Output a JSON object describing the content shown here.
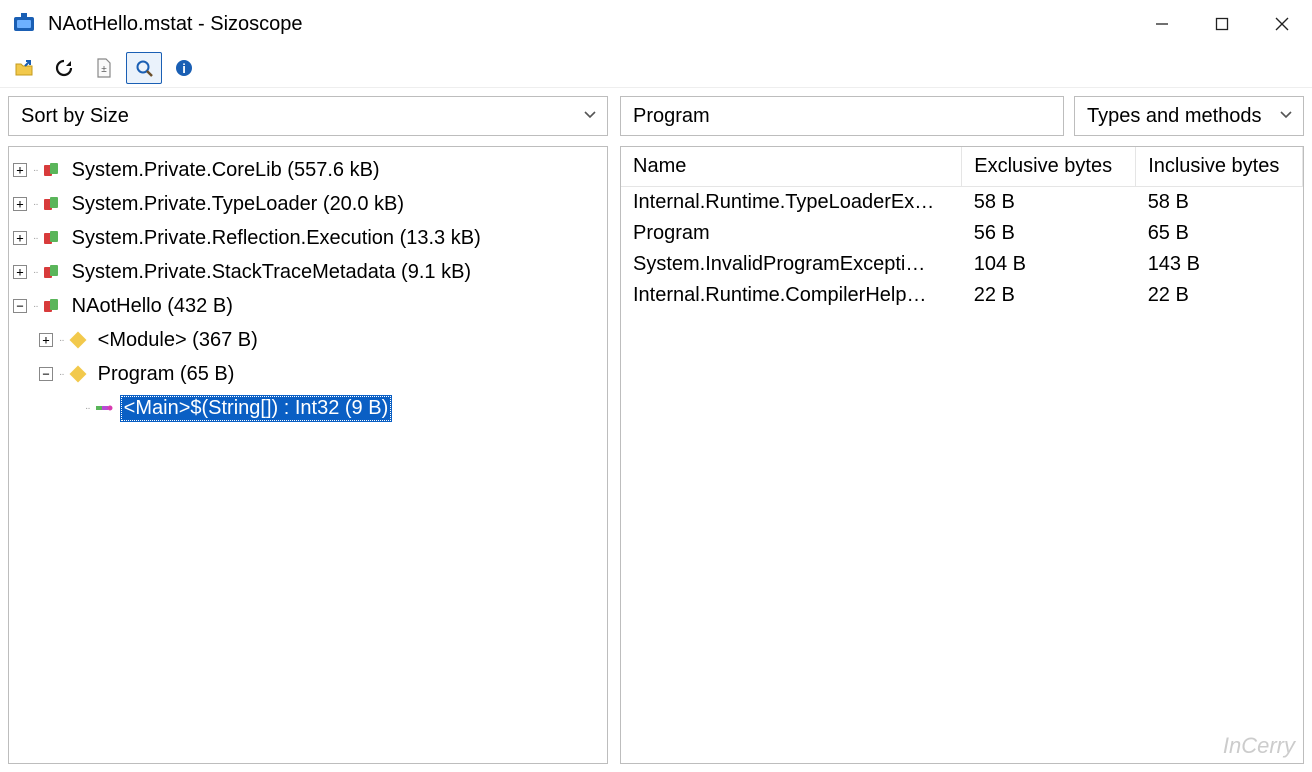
{
  "window": {
    "title": "NAotHello.mstat - Sizoscope"
  },
  "toolbar": {
    "open": "Open",
    "refresh": "Refresh",
    "document": "Document",
    "search": "Search",
    "info": "Info"
  },
  "left": {
    "sort_label": "Sort by Size",
    "tree": [
      {
        "label": "System.Private.CoreLib (557.6 kB)",
        "icon": "assembly",
        "expander": "+",
        "indent": 0
      },
      {
        "label": "System.Private.TypeLoader (20.0 kB)",
        "icon": "assembly",
        "expander": "+",
        "indent": 0
      },
      {
        "label": "System.Private.Reflection.Execution (13.3 kB)",
        "icon": "assembly",
        "expander": "+",
        "indent": 0
      },
      {
        "label": "System.Private.StackTraceMetadata (9.1 kB)",
        "icon": "assembly",
        "expander": "+",
        "indent": 0
      },
      {
        "label": "NAotHello (432 B)",
        "icon": "assembly",
        "expander": "-",
        "indent": 0
      },
      {
        "label": "<Module> (367 B)",
        "icon": "class",
        "expander": "+",
        "indent": 1
      },
      {
        "label": "Program (65 B)",
        "icon": "class",
        "expander": "-",
        "indent": 1
      },
      {
        "label": "<Main>$(String[]) : Int32 (9 B)",
        "icon": "method",
        "expander": "",
        "indent": 2,
        "selected": true
      }
    ]
  },
  "right": {
    "search_value": "Program",
    "filter_label": "Types and methods",
    "columns": [
      "Name",
      "Exclusive bytes",
      "Inclusive bytes"
    ],
    "rows": [
      {
        "name": "Internal.Runtime.TypeLoaderEx…",
        "excl": "58 B",
        "incl": "58 B"
      },
      {
        "name": "Program",
        "excl": "56 B",
        "incl": "65 B"
      },
      {
        "name": "System.InvalidProgramExcepti…",
        "excl": "104 B",
        "incl": "143 B"
      },
      {
        "name": "Internal.Runtime.CompilerHelp…",
        "excl": "22 B",
        "incl": "22 B"
      }
    ]
  },
  "watermark": "InCerry"
}
